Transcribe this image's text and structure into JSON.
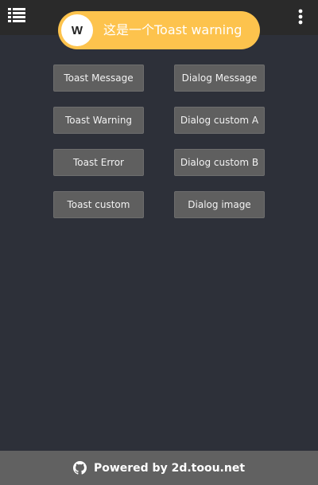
{
  "header": {
    "menu_icon": "list-icon",
    "more_icon": "vertical-dots-icon"
  },
  "toast": {
    "badge": "W",
    "message": "这是一个Toast warning",
    "color": "#fdc34d"
  },
  "buttons": {
    "toast_message": "Toast Message",
    "dialog_message": "Dialog Message",
    "toast_warning": "Toast Warning",
    "dialog_custom_a": "Dialog custom A",
    "toast_error": "Toast Error",
    "dialog_custom_b": "Dialog custom B",
    "toast_custom": "Toast custom",
    "dialog_image": "Dialog image"
  },
  "footer": {
    "icon": "github-icon",
    "label": "Powered by 2d.toou.net"
  },
  "colors": {
    "background": "#2d3039",
    "header": "#2a2a2a",
    "button": "#5f5f5f",
    "footer": "#616161"
  }
}
